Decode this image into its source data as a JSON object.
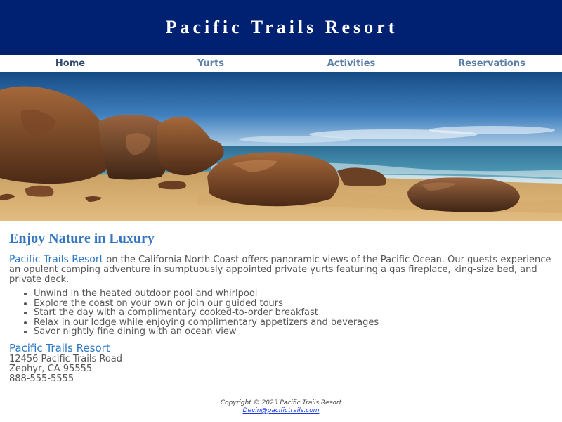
{
  "header": {
    "title": "Pacific Trails Resort"
  },
  "nav": {
    "items": [
      {
        "label": "Home"
      },
      {
        "label": "Yurts"
      },
      {
        "label": "Activities"
      },
      {
        "label": "Reservations"
      }
    ]
  },
  "hero": {
    "description": "Sandy beach with large brown rocks and the ocean under a blue sky",
    "icon": "beach-photo"
  },
  "main": {
    "heading": "Enjoy Nature in Luxury",
    "intro_brand": "Pacific Trails Resort",
    "intro_text": " on the California North Coast offers panoramic views of the Pacific Ocean. Our guests experience an opulent camping adventure in sumptuously appointed private yurts featuring a gas fireplace, king-size bed, and private deck.",
    "features": [
      "Unwind in the heated outdoor pool and whirlpool",
      "Explore the coast on your own or join our guided tours",
      "Start the day with a complimentary cooked-to-order breakfast",
      "Relax in our lodge while enjoying complimentary appetizers and beverages",
      "Savor nightly fine dining with an ocean view"
    ]
  },
  "contact": {
    "name": "Pacific Trails Resort",
    "street": "12456 Pacific Trails Road",
    "city": "Zephyr, CA 95555",
    "phone": "888-555-5555"
  },
  "footer": {
    "copyright": "Copyright © 2023 Pacific Trails Resort",
    "email": "Devin@pacifictrails.com"
  },
  "colors": {
    "header_bg": "#002171",
    "heading": "#3477bf",
    "nav_text": "#5c7fa6",
    "nav_active": "#344a6e",
    "link": "#1a3ae8"
  }
}
